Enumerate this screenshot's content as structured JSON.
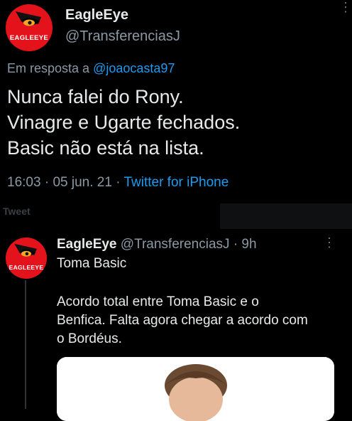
{
  "tweet": {
    "avatar_text": "EAGLEEYE",
    "name": "EagleEye",
    "handle": "@TransferenciasJ",
    "reply_prefix": "Em resposta a",
    "reply_mention": "@joaocasta97",
    "lines": [
      "Nunca falei do Rony.",
      "Vinagre e Ugarte fechados.",
      "Basic não está na lista."
    ],
    "time": "16:03",
    "sep1": "·",
    "date": "05 jun. 21",
    "sep2": "·",
    "source": "Twitter for iPhone"
  },
  "section_label": "Tweet",
  "quoted": {
    "avatar_text": "EAGLEEYE",
    "name": "EagleEye",
    "handle": "@TransferenciasJ",
    "sep": "·",
    "age": "9h",
    "line1": "Toma Basic",
    "body_lines": [
      "Acordo total entre Toma Basic e o",
      "Benfica. Falta agora chegar a acordo com",
      "o Bordéus."
    ]
  },
  "colors": {
    "background": "#000000",
    "text": "#e7e9ea",
    "secondary": "#8b98a5",
    "link": "#1d9bf0",
    "avatar": "#e4121b"
  },
  "icons": [
    "more-icon",
    "eagle-logo-icon"
  ]
}
